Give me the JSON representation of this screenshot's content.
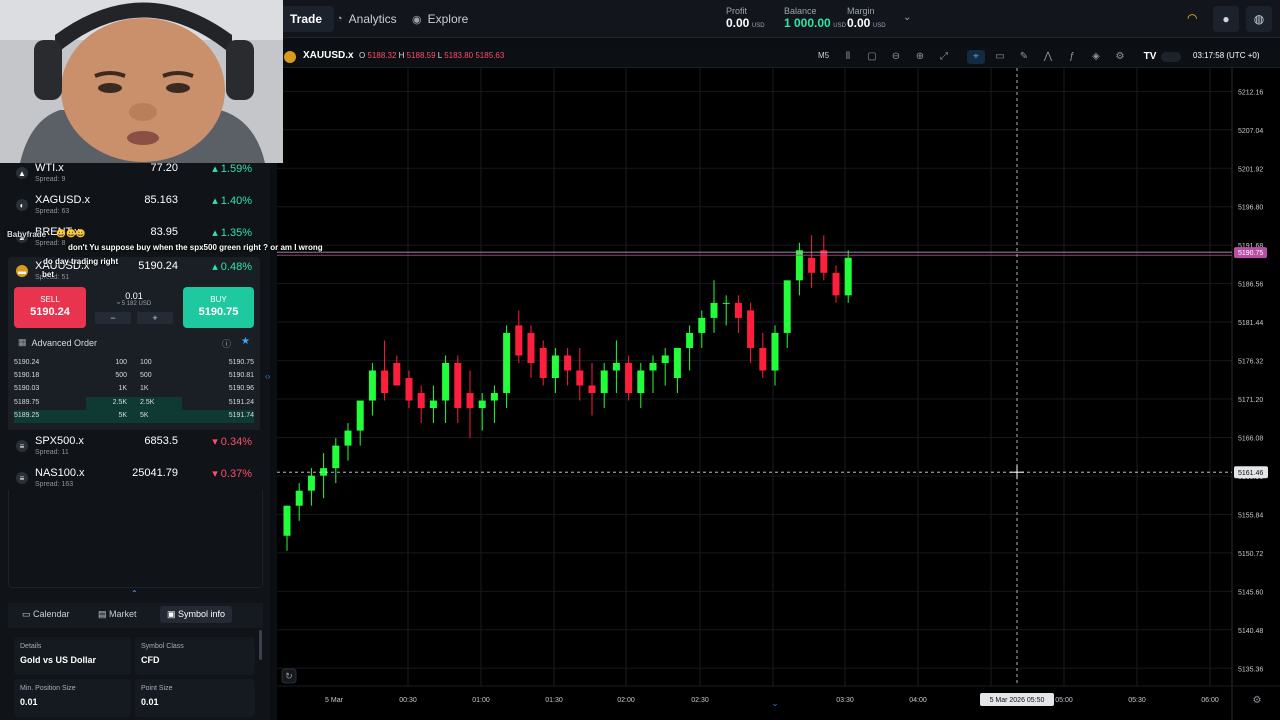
{
  "nav": {
    "tabs": [
      {
        "label": "Trade",
        "icon": "trade-icon"
      },
      {
        "label": "Analytics",
        "icon": "analytics-icon"
      },
      {
        "label": "Explore",
        "icon": "explore-icon"
      }
    ],
    "profit": {
      "label": "Profit",
      "value": "0.00",
      "unit": "USD"
    },
    "balance": {
      "label": "Balance",
      "value": "1 000.00",
      "unit": "USD"
    },
    "margin": {
      "label": "Margin",
      "value": "0.00",
      "unit": "USD"
    }
  },
  "symbols": [
    {
      "name": "WTI.x",
      "spread": "Spread: 9",
      "price": "77.20",
      "change": "1.59%",
      "dir": "up"
    },
    {
      "name": "XAGUSD.x",
      "spread": "Spread: 63",
      "price": "85.163",
      "change": "1.40%",
      "dir": "up"
    },
    {
      "name": "BRENT.x",
      "spread": "Spread: 8",
      "price": "83.95",
      "change": "1.35%",
      "dir": "up"
    },
    {
      "name": "XAUUSD.x",
      "spread": "Spread: 51",
      "price": "5190.24",
      "change": "0.48%",
      "dir": "up"
    }
  ],
  "trade": {
    "sell_label": "SELL",
    "sell_price": "5190.24",
    "buy_label": "BUY",
    "buy_price": "5190.75",
    "qty": "0.01",
    "qty_usd": "≈ 5 182 USD",
    "minus": "−",
    "plus": "+",
    "advanced_label": "Advanced Order"
  },
  "orderbook": [
    {
      "bid": "5190.24",
      "bv": "100",
      "av": "100",
      "ask": "5190.75"
    },
    {
      "bid": "5190.18",
      "bv": "500",
      "av": "500",
      "ask": "5190.81"
    },
    {
      "bid": "5190.03",
      "bv": "1K",
      "av": "1K",
      "ask": "5190.96"
    },
    {
      "bid": "5189.75",
      "bv": "2.5K",
      "av": "2.5K",
      "ask": "5191.24"
    },
    {
      "bid": "5189.25",
      "bv": "5K",
      "av": "5K",
      "ask": "5191.74"
    }
  ],
  "symbols2": [
    {
      "name": "SPX500.x",
      "spread": "Spread: 11",
      "price": "6853.5",
      "change": "0.34%",
      "dir": "down"
    },
    {
      "name": "NAS100.x",
      "spread": "Spread: 163",
      "price": "25041.79",
      "change": "0.37%",
      "dir": "down"
    }
  ],
  "bottom_tabs": [
    "Calendar",
    "Market",
    "Symbol info"
  ],
  "symbol_info": {
    "details_label": "Details",
    "details_value": "Gold vs US Dollar",
    "class_label": "Symbol Class",
    "class_value": "CFD",
    "minpos_label": "Min. Position Size",
    "minpos_value": "0.01",
    "point_label": "Point Size",
    "point_value": "0.01"
  },
  "chat": {
    "user": "Babyfrade",
    "message": "don't Yu suppose buy when the spx500 green right ? or am I wrong",
    "message2": "do day trading right",
    "message3": "bet"
  },
  "chart_header": {
    "symbol": "XAUUSD.x",
    "o_label": "O",
    "o": "5188.32",
    "h_label": "H",
    "h": "5188.59",
    "l_label": "L",
    "l": "5183.80",
    "c": "5185.63",
    "timeframe": "M5",
    "clock": "03:17:58 (UTC +0)"
  },
  "chart_data": {
    "type": "candlestick",
    "ylim": [
      5133,
      5215
    ],
    "y_ticks": [
      5212.16,
      5207.04,
      5201.92,
      5196.8,
      5191.68,
      5186.56,
      5181.44,
      5176.32,
      5171.2,
      5166.08,
      5160.96,
      5155.84,
      5150.72,
      5145.6,
      5140.48,
      5135.36
    ],
    "x_ticks": [
      "5 Mar",
      "00:30",
      "01:00",
      "01:30",
      "02:00",
      "02:30",
      "03:30",
      "04:00",
      "05:00",
      "05:30",
      "06:00"
    ],
    "price_line": 5190.75,
    "cursor_price": "5161.46",
    "cursor_time": "5 Mar 2026 05:50",
    "candles": [
      [
        5153,
        5157,
        5151,
        5157
      ],
      [
        5157,
        5160,
        5155,
        5159
      ],
      [
        5159,
        5162,
        5157,
        5161
      ],
      [
        5161,
        5164,
        5158,
        5162
      ],
      [
        5162,
        5166,
        5160,
        5165
      ],
      [
        5165,
        5168,
        5163,
        5167
      ],
      [
        5167,
        5171,
        5165,
        5171
      ],
      [
        5171,
        5176,
        5169,
        5175
      ],
      [
        5175,
        5179,
        5171,
        5172
      ],
      [
        5176,
        5177,
        5173,
        5173
      ],
      [
        5174,
        5175,
        5170,
        5171
      ],
      [
        5172,
        5173,
        5168,
        5170
      ],
      [
        5170,
        5173,
        5168,
        5171
      ],
      [
        5171,
        5177,
        5168,
        5176
      ],
      [
        5176,
        5177,
        5168,
        5170
      ],
      [
        5172,
        5175,
        5166,
        5170
      ],
      [
        5170,
        5172,
        5167,
        5171
      ],
      [
        5171,
        5173,
        5168,
        5172
      ],
      [
        5172,
        5181,
        5170,
        5180
      ],
      [
        5181,
        5183,
        5176,
        5177
      ],
      [
        5180,
        5181,
        5174,
        5176
      ],
      [
        5178,
        5179,
        5173,
        5174
      ],
      [
        5174,
        5178,
        5172,
        5177
      ],
      [
        5177,
        5178,
        5173,
        5175
      ],
      [
        5175,
        5178,
        5171,
        5173
      ],
      [
        5173,
        5176,
        5169,
        5172
      ],
      [
        5172,
        5176,
        5170,
        5175
      ],
      [
        5175,
        5179,
        5172,
        5176
      ],
      [
        5176,
        5177,
        5171,
        5172
      ],
      [
        5172,
        5176,
        5170,
        5175
      ],
      [
        5175,
        5177,
        5172,
        5176
      ],
      [
        5176,
        5178,
        5173,
        5177
      ],
      [
        5174,
        5178,
        5172,
        5178
      ],
      [
        5178,
        5181,
        5175,
        5180
      ],
      [
        5180,
        5183,
        5178,
        5182
      ],
      [
        5182,
        5187,
        5180,
        5184
      ],
      [
        5184,
        5185,
        5181,
        5184
      ],
      [
        5184,
        5185,
        5180,
        5182
      ],
      [
        5183,
        5184,
        5176,
        5178
      ],
      [
        5178,
        5180,
        5174,
        5175
      ],
      [
        5175,
        5181,
        5173,
        5180
      ],
      [
        5180,
        5187,
        5178,
        5187
      ],
      [
        5187,
        5192,
        5185,
        5191
      ],
      [
        5190,
        5193,
        5186,
        5188
      ],
      [
        5191,
        5193,
        5187,
        5188
      ],
      [
        5188,
        5189,
        5184,
        5185
      ],
      [
        5185,
        5191,
        5184,
        5190
      ]
    ]
  }
}
